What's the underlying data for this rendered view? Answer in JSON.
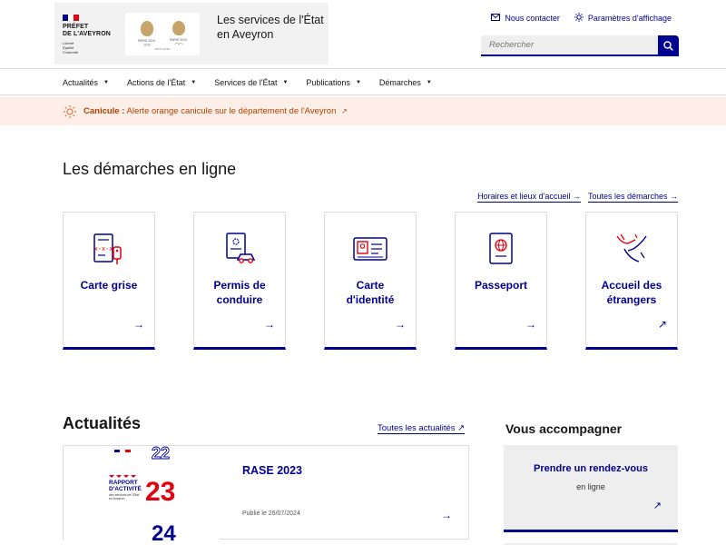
{
  "header": {
    "prefet_name_line1": "PRÉFET",
    "prefet_name_line2": "DE L'AVEYRON",
    "devise_1": "Liberté",
    "devise_2": "Égalité",
    "devise_3": "Fraternité",
    "olympic_left": "PARIS 2024",
    "olympic_right": "PARIS 2024",
    "olympic_sub": "PAYS HÔTE",
    "service_title": "Les services de l'État en Aveyron",
    "contact_label": "Nous contacter",
    "display_label": "Paramètres d'affichage",
    "search_placeholder": "Rechercher"
  },
  "nav": {
    "items": [
      "Actualités",
      "Actions de l'État",
      "Services de l'État",
      "Publications",
      "Démarches"
    ]
  },
  "alert": {
    "label": "Canicule :",
    "text": "Alerte orange canicule sur le département de l'Aveyron"
  },
  "demarches": {
    "title": "Les démarches en ligne",
    "link_horaires": "Horaires et lieux d'accueil",
    "link_all": "Toutes les démarches",
    "cards": [
      {
        "label_1": "Carte grise",
        "label_2": "",
        "icon": "car-registration-icon",
        "arrow": "→"
      },
      {
        "label_1": "Permis de",
        "label_2": "conduire",
        "icon": "driving-license-icon",
        "arrow": "→"
      },
      {
        "label_1": "Carte",
        "label_2": "d'identité",
        "icon": "id-card-icon",
        "arrow": "→"
      },
      {
        "label_1": "Passeport",
        "label_2": "",
        "icon": "passport-icon",
        "arrow": "→"
      },
      {
        "label_1": "Accueil des",
        "label_2": "étrangers",
        "icon": "welcome-hands-icon",
        "arrow": "↗"
      }
    ]
  },
  "actualites": {
    "title": "Actualités",
    "all_link": "Toutes les actualités",
    "news": {
      "title": "RASE 2023",
      "date": "Publié le 26/07/2024",
      "img_text_1": "RAPPORT",
      "img_text_2": "D'ACTIVITÉ",
      "img_text_3": "des services de l'État",
      "img_text_4": "en Aveyron",
      "img_num_1": "22",
      "img_num_2": "23",
      "img_num_3": "24"
    }
  },
  "accompagner": {
    "title": "Vous accompagner",
    "card_title": "Prendre un rendez-vous",
    "card_sub": "en ligne"
  },
  "colors": {
    "primary": "#000091",
    "alert_bg": "#fdeee8",
    "alert_text": "#b34000",
    "accent_red": "#e1000f"
  }
}
